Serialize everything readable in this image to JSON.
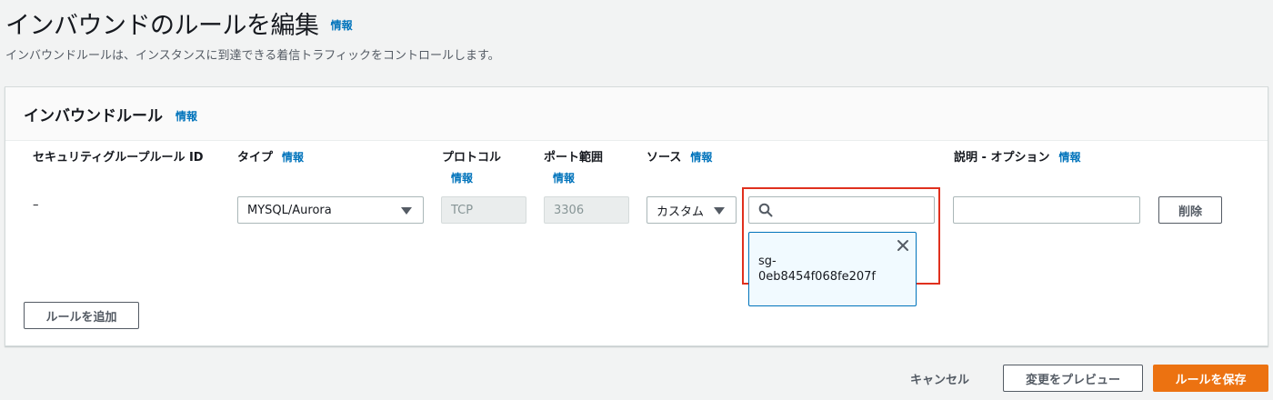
{
  "page": {
    "title": "インバウンドのルールを編集",
    "info": "情報",
    "description": "インバウンドルールは、インスタンスに到達できる着信トラフィックをコントロールします。"
  },
  "card": {
    "title": "インバウンドルール",
    "info": "情報",
    "columns": {
      "rule_id": "セキュリティグループルール ID",
      "type": "タイプ",
      "type_info": "情報",
      "protocol": "プロトコル",
      "protocol_info": "情報",
      "port_range": "ポート範囲",
      "port_range_info": "情報",
      "source": "ソース",
      "source_info": "情報",
      "description": "説明 - オプション",
      "description_info": "情報"
    },
    "rule": {
      "rule_id": "–",
      "type": "MYSQL/Aurora",
      "protocol": "TCP",
      "port_range": "3306",
      "source_type": "カスタム",
      "source_search_value": "",
      "source_token": "sg-\n0eb8454f068fe207f",
      "description_value": "",
      "delete_label": "削除"
    },
    "add_rule_label": "ルールを追加"
  },
  "footer": {
    "cancel_label": "キャンセル",
    "preview_label": "変更をプレビュー",
    "save_label": "ルールを保存"
  },
  "colors": {
    "primary": "#ec7211",
    "link": "#0073bb",
    "highlight": "#e0301e"
  }
}
